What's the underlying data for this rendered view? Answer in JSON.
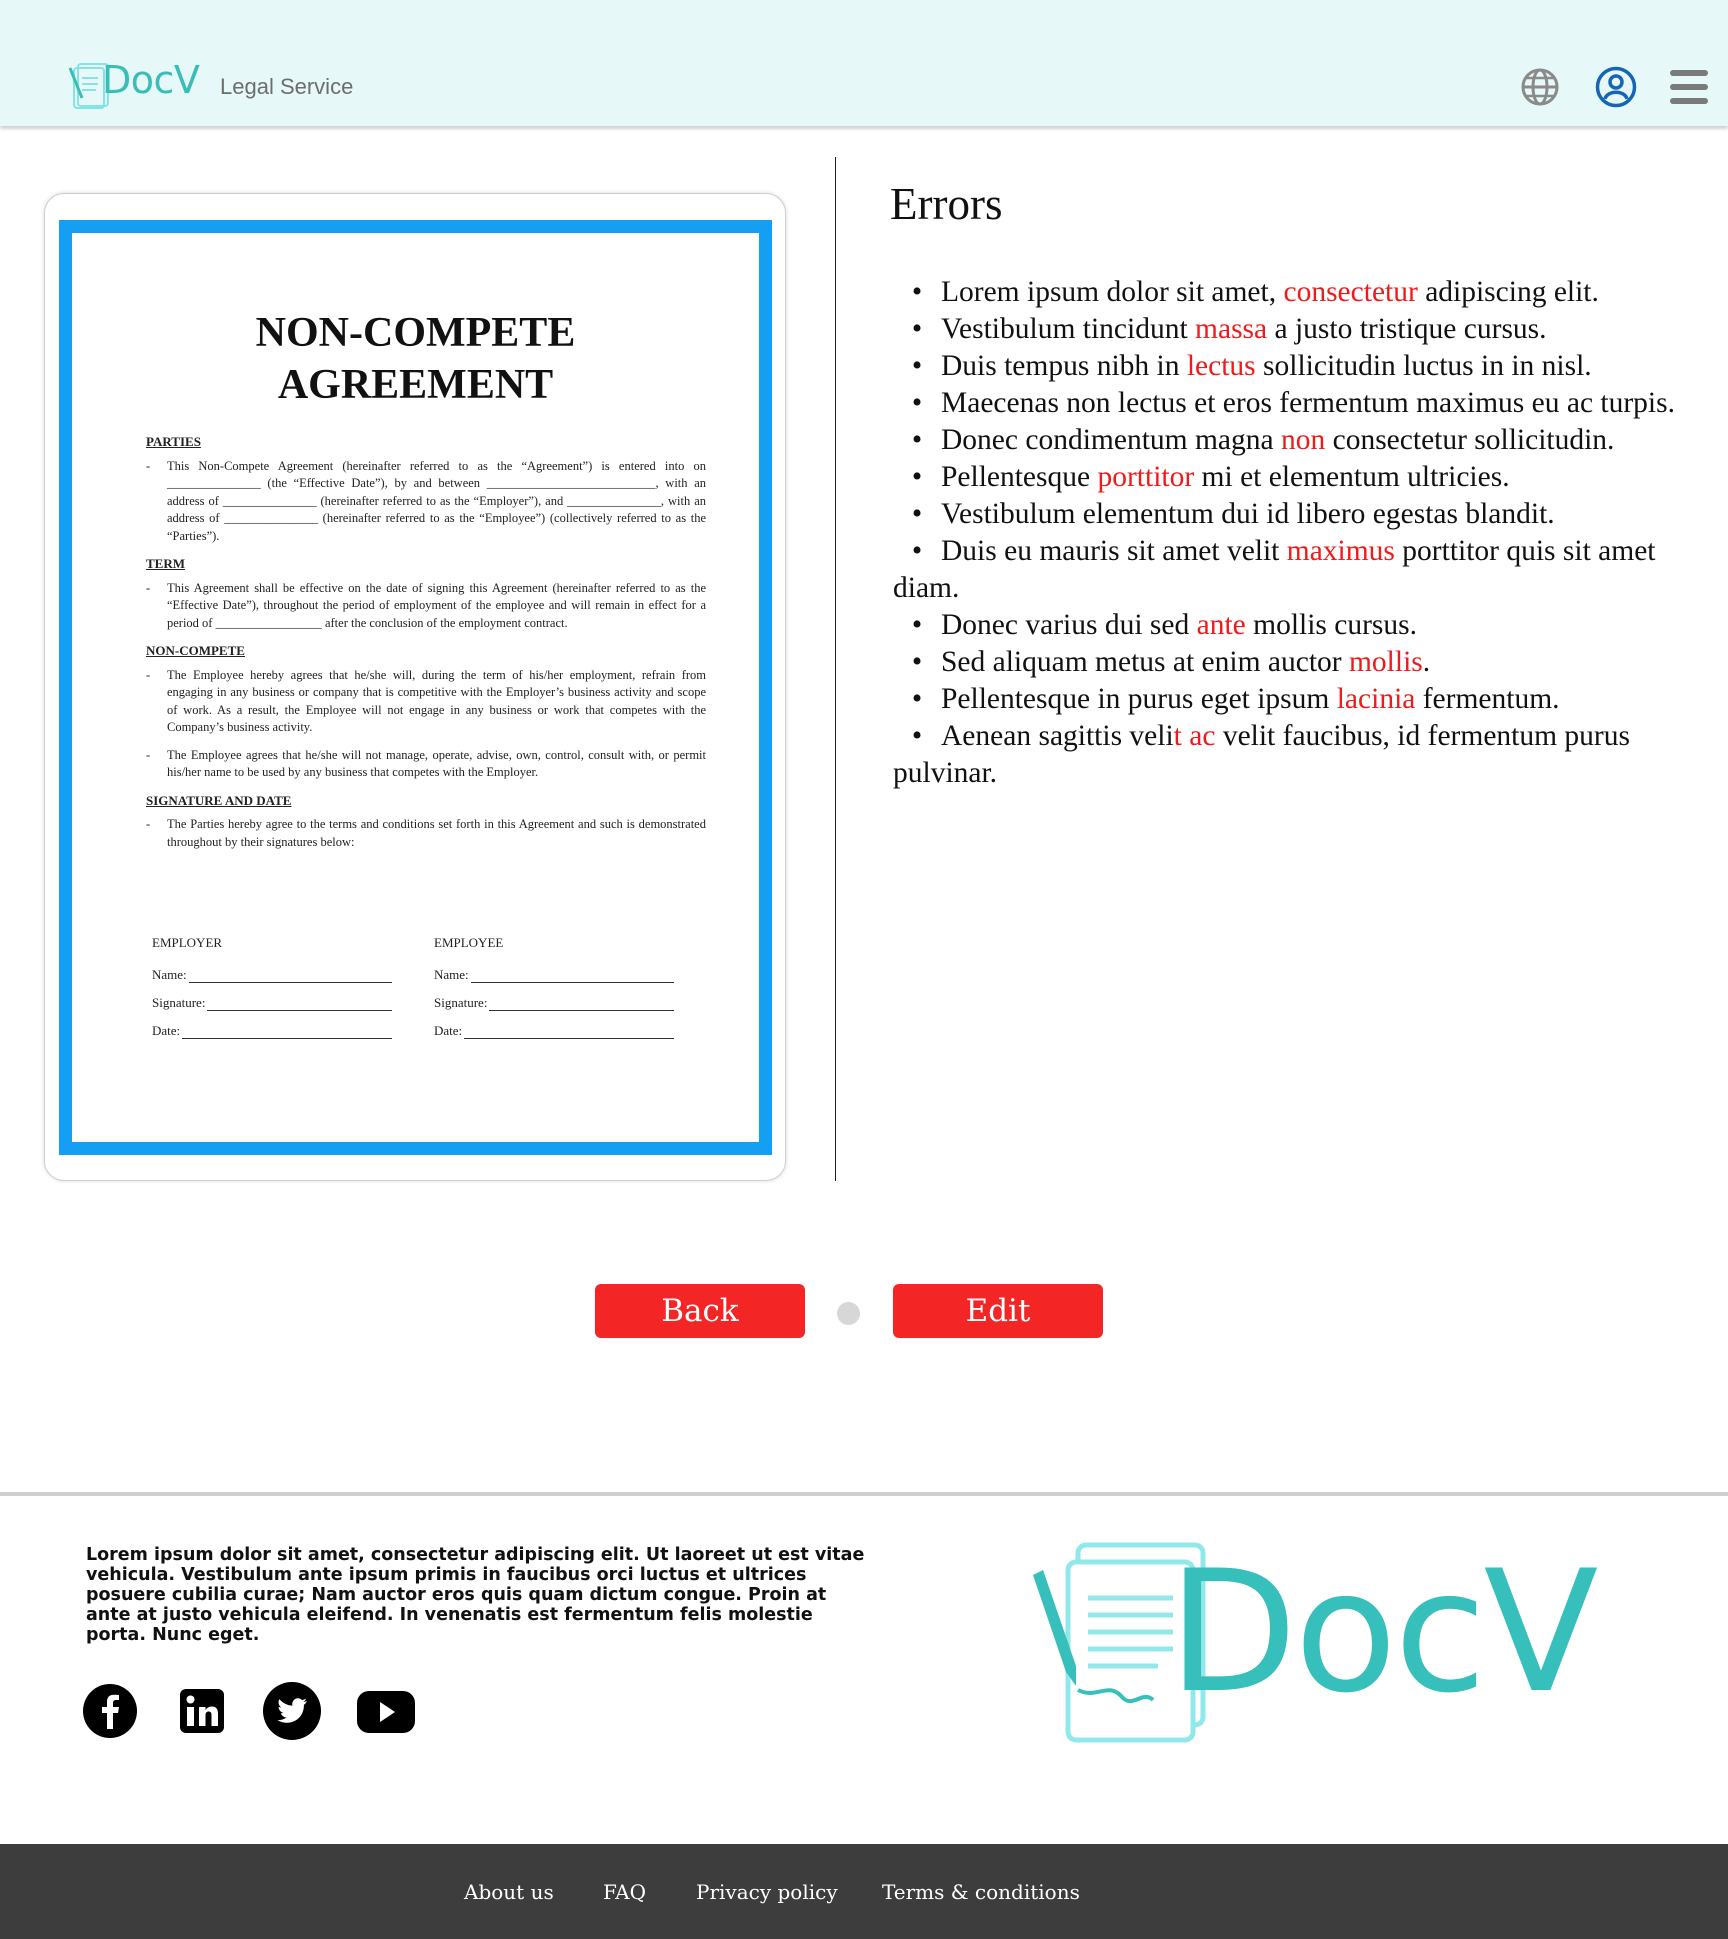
{
  "header": {
    "brand": "DocV",
    "tagline": "Legal Service",
    "icons": [
      "globe-icon",
      "user-account-icon",
      "hamburger-menu-icon"
    ]
  },
  "document": {
    "title_line1": "NON-COMPETE",
    "title_line2": "AGREEMENT",
    "sections": {
      "parties_heading": "PARTIES",
      "parties_text": "This Non-Compete Agreement (hereinafter referred to as the “Agreement”) is entered into on _______________ (the “Effective Date”), by and between ___________________________, with an address of _______________ (hereinafter referred to as the “Employer”), and _______________, with an address of _______________ (hereinafter referred to as the “Employee”) (collectively referred to as the “Parties”).",
      "term_heading": "TERM",
      "term_text": "This Agreement shall be effective on the date of signing this Agreement (hereinafter referred to as the “Effective Date”), throughout the period of employment of the employee and will remain in effect for a period of _________________ after the conclusion of the employment contract.",
      "noncompete_heading": "NON-COMPETE",
      "noncompete_text1": "The Employee hereby agrees that he/she will, during the term of his/her employment, refrain from engaging in any business or company that is competitive with the Employer’s business activity and scope of work. As a result, the Employee will not engage in any business or work that competes with the Company’s business activity.",
      "noncompete_text2": "The Employee agrees that he/she will not manage, operate, advise, own, control, consult with, or permit his/her name to be used by any business that competes with the Employer.",
      "signature_heading": "SIGNATURE AND DATE",
      "signature_text": "The Parties hereby agree to the terms and conditions set forth in this Agreement and such is demonstrated throughout by their signatures below:"
    },
    "signatures": {
      "employer": "EMPLOYER",
      "employee": "EMPLOYEE",
      "name_label": "Name:",
      "signature_label": "Signature:",
      "date_label": "Date:"
    }
  },
  "errors": {
    "title": "Errors",
    "items": [
      {
        "before": "Lorem ipsum dolor sit amet, ",
        "highlight": "consectetur",
        "after": " adipiscing elit."
      },
      {
        "before": "Vestibulum tincidunt ",
        "highlight": "massa",
        "after": " a justo tristique cursus."
      },
      {
        "before": "Duis tempus nibh in ",
        "highlight": "lectus",
        "after": " sollicitudin luctus in in nisl."
      },
      {
        "before": "Maecenas non lectus et eros fermentum maximus eu ac turpis.",
        "highlight": "",
        "after": ""
      },
      {
        "before": "Donec condimentum magna ",
        "highlight": "non",
        "after": " consectetur sollicitudin."
      },
      {
        "before": "Pellentesque ",
        "highlight": "porttitor",
        "after": " mi et elementum ultricies."
      },
      {
        "before": "Vestibulum elementum dui id libero egestas blandit.",
        "highlight": "",
        "after": ""
      },
      {
        "before": "Duis eu mauris sit amet velit ",
        "highlight": "maximus",
        "after": " porttitor quis sit amet diam."
      },
      {
        "before": "Donec varius dui sed ",
        "highlight": "ante",
        "after": " mollis cursus."
      },
      {
        "before": "Sed aliquam metus at enim auctor ",
        "highlight": "mollis",
        "after": "."
      },
      {
        "before": "Pellentesque in purus eget ipsum ",
        "highlight": "lacinia",
        "after": " fermentum."
      },
      {
        "before": "Aenean sagittis veli",
        "highlight": "t ac",
        "after": " velit faucibus, id fermentum purus pulvinar."
      }
    ],
    "highlight_color": "#ef1a1a"
  },
  "actions": {
    "back_label": "Back",
    "edit_label": "Edit"
  },
  "footer": {
    "text": "Lorem ipsum dolor sit amet, consectetur adipiscing elit. Ut laoreet ut est vitae vehicula. Vestibulum ante ipsum primis in faucibus orci luctus et ultrices posuere cubilia curae; Nam auctor eros quis quam dictum congue. Proin at ante at justo vehicula eleifend. In venenatis est fermentum felis molestie porta. Nunc eget.",
    "social": [
      "facebook-icon",
      "linkedin-icon",
      "twitter-icon",
      "youtube-icon"
    ],
    "brand": "DocV",
    "links": {
      "about": "About us",
      "faq": "FAQ",
      "privacy": "Privacy policy",
      "terms": "Terms & conditions"
    }
  },
  "colors": {
    "brand_teal": "#39bdb8",
    "header_bg": "#e6f8f7",
    "button_red": "#f42525",
    "doc_border_blue": "#149ff2",
    "footer_bar": "#3d3d3d"
  }
}
